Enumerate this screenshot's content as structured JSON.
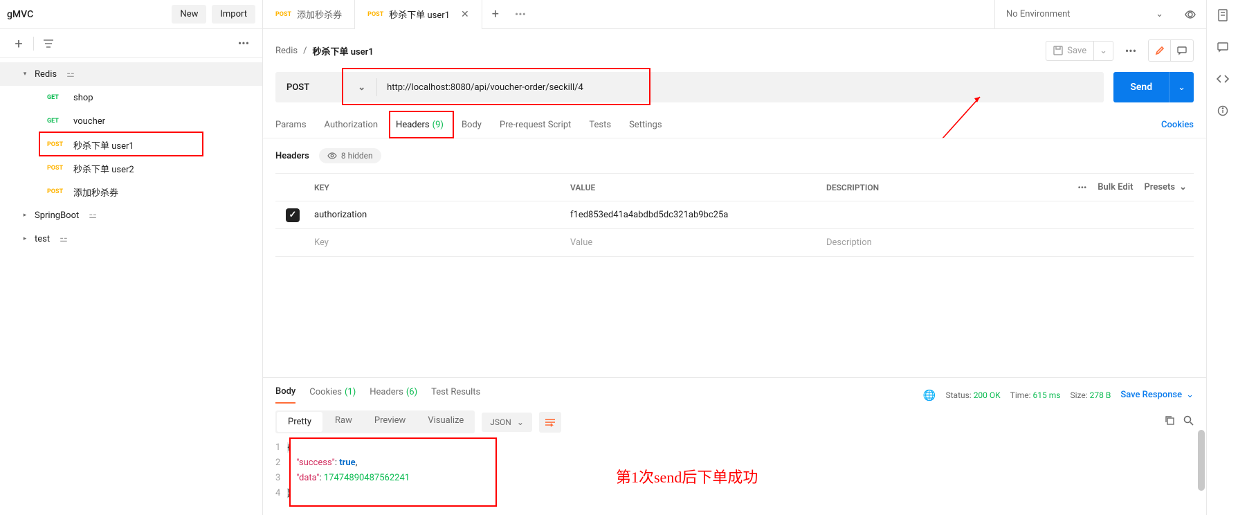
{
  "sidebar": {
    "workspace": "gMVC",
    "new_label": "New",
    "import_label": "Import",
    "tree": [
      {
        "type": "folder",
        "name": "Redis",
        "expanded": true,
        "people": true
      },
      {
        "type": "request",
        "method": "GET",
        "name": "shop"
      },
      {
        "type": "request",
        "method": "GET",
        "name": "voucher"
      },
      {
        "type": "request",
        "method": "POST",
        "name": "秒杀下单 user1",
        "active": true,
        "highlight": true
      },
      {
        "type": "request",
        "method": "POST",
        "name": "秒杀下单 user2"
      },
      {
        "type": "request",
        "method": "POST",
        "name": "添加秒杀券"
      },
      {
        "type": "folder",
        "name": "SpringBoot",
        "expanded": false,
        "people": true,
        "collapsed": true
      },
      {
        "type": "folder",
        "name": "test",
        "expanded": false,
        "people": true,
        "collapsed": true
      }
    ]
  },
  "tabs": [
    {
      "method": "POST",
      "label": "添加秒杀券",
      "active": false
    },
    {
      "method": "POST",
      "label": "秒杀下单 user1",
      "active": true,
      "close": true
    }
  ],
  "env_label": "No Environment",
  "breadcrumb": {
    "parent": "Redis",
    "current": "秒杀下单 user1",
    "save_label": "Save"
  },
  "request": {
    "method": "POST",
    "url": "http://localhost:8080/api/voucher-order/seckill/4",
    "send_label": "Send",
    "tabs": [
      "Params",
      "Authorization",
      "Headers",
      "Body",
      "Pre-request Script",
      "Tests",
      "Settings"
    ],
    "active_tab": "Headers",
    "headers_count": "(9)",
    "cookies_label": "Cookies",
    "headers_title": "Headers",
    "hidden_label": "8 hidden",
    "table_headers": {
      "key": "KEY",
      "value": "VALUE",
      "desc": "DESCRIPTION",
      "bulk": "Bulk Edit",
      "presets": "Presets"
    },
    "headers": [
      {
        "enabled": true,
        "key": "authorization",
        "value": "f1ed853ed41a4abdbd5dc321ab9bc25a",
        "desc": ""
      }
    ],
    "placeholders": {
      "key": "Key",
      "value": "Value",
      "desc": "Description"
    }
  },
  "response": {
    "tabs": {
      "body": "Body",
      "cookies": "Cookies",
      "cookies_count": "(1)",
      "headers": "Headers",
      "headers_count": "(6)",
      "tests": "Test Results"
    },
    "status_label": "Status:",
    "status_value": "200 OK",
    "time_label": "Time:",
    "time_value": "615 ms",
    "size_label": "Size:",
    "size_value": "278 B",
    "save_label": "Save Response",
    "views": [
      "Pretty",
      "Raw",
      "Preview",
      "Visualize"
    ],
    "lang": "JSON",
    "body_lines": [
      {
        "n": "1",
        "html": "bracket-open"
      },
      {
        "n": "2",
        "html": "success"
      },
      {
        "n": "3",
        "html": "data"
      },
      {
        "n": "4",
        "html": "bracket-close"
      }
    ],
    "json": {
      "success_key": "\"success\"",
      "success_val": "true",
      "data_key": "\"data\"",
      "data_val": "17474890487562241"
    }
  },
  "annotation": "第1次send后下单成功"
}
